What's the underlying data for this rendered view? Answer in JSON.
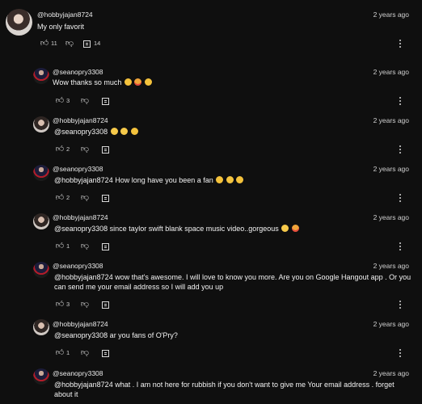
{
  "comments": [
    {
      "username": "@hobbyjajan8724",
      "time": "2 years ago",
      "text": "My only favorit",
      "likes": "11",
      "replies": "14",
      "avatar": "woman-avatar"
    },
    {
      "username": "@seanopry3308",
      "time": "2 years ago",
      "text": "Wow thanks so much ",
      "likes": "3",
      "avatar": "man-avatar"
    },
    {
      "username": "@hobbyjajan8724",
      "time": "2 years ago",
      "text": "@seanopry3308  ",
      "likes": "2",
      "avatar": "woman-avatar"
    },
    {
      "username": "@seanopry3308",
      "time": "2 years ago",
      "text": "@hobbyjajan8724  How long have you been a fan ",
      "likes": "2",
      "avatar": "man-avatar"
    },
    {
      "username": "@hobbyjajan8724",
      "time": "2 years ago",
      "text": "@seanopry3308  since taylor swift blank space music video..gorgeous",
      "likes": "1",
      "avatar": "woman-avatar"
    },
    {
      "username": "@seanopry3308",
      "time": "2 years ago",
      "text": "@hobbyjajan8724  wow that's awesome. I will love to know you more. Are you on Google Hangout app . Or you can send me your email address so I will add you up",
      "likes": "3",
      "avatar": "man-avatar"
    },
    {
      "username": "@hobbyjajan8724",
      "time": "2 years ago",
      "text": "@seanopry3308  ar you fans of O'Pry?",
      "likes": "1",
      "avatar": "woman-avatar"
    },
    {
      "username": "@seanopry3308",
      "time": "2 years ago",
      "text": "@hobbyjajan8724  what  . I am not here for rubbish if you don't want to give me Your email address . forget about it",
      "avatar": "man-avatar"
    }
  ],
  "icons": {
    "like": "thumbs-up-icon",
    "dislike": "thumbs-down-icon",
    "reply": "reply-icon",
    "more": "more-options-icon"
  }
}
